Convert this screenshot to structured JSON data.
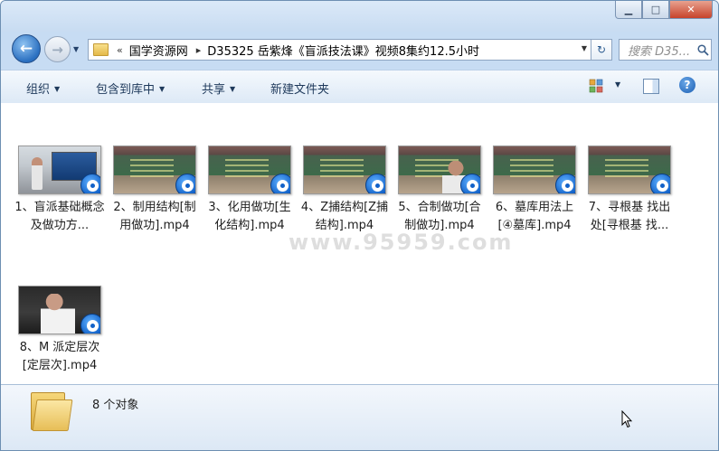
{
  "window": {
    "minimize_glyph": "▁",
    "maximize_glyph": "□",
    "close_glyph": "✕"
  },
  "nav": {
    "back_glyph": "←",
    "forward_glyph": "→",
    "history_glyph": "▼"
  },
  "address": {
    "prefix": "«",
    "crumbs": [
      "国学资源网",
      "D35325 岳紫烽《盲派技法课》视频8集约12.5小时"
    ],
    "separator": "▸",
    "dropdown_glyph": "▼",
    "refresh_glyph": "↻"
  },
  "search": {
    "placeholder": "搜索 D35..."
  },
  "toolbar": {
    "organize": "组织",
    "include_in_library": "包含到库中",
    "share": "共享",
    "new_folder": "新建文件夹",
    "help": "?",
    "caret": "▼"
  },
  "files": [
    {
      "label": "1、盲派基础概念及做功方...",
      "thumb": "room"
    },
    {
      "label": "2、制用结构[制用做功].mp4",
      "thumb": "board"
    },
    {
      "label": "3、化用做功[生化结构].mp4",
      "thumb": "board"
    },
    {
      "label": "4、Z捕结构[Z捕结构].mp4",
      "thumb": "board"
    },
    {
      "label": "5、合制做功[合制做功].mp4",
      "thumb": "board-person"
    },
    {
      "label": "6、墓库用法上[④墓库].mp4",
      "thumb": "board"
    },
    {
      "label": "7、寻根基 找出处[寻根基 找...",
      "thumb": "board"
    },
    {
      "label": "8、M 派定层次[定层次].mp4",
      "thumb": "dark"
    }
  ],
  "watermark": "www.95959.com",
  "status": {
    "count": "8 个对象"
  },
  "colors": {
    "accent": "#1161c8",
    "toolbar_text": "#1e395b",
    "frame": "#c7dcf3"
  }
}
